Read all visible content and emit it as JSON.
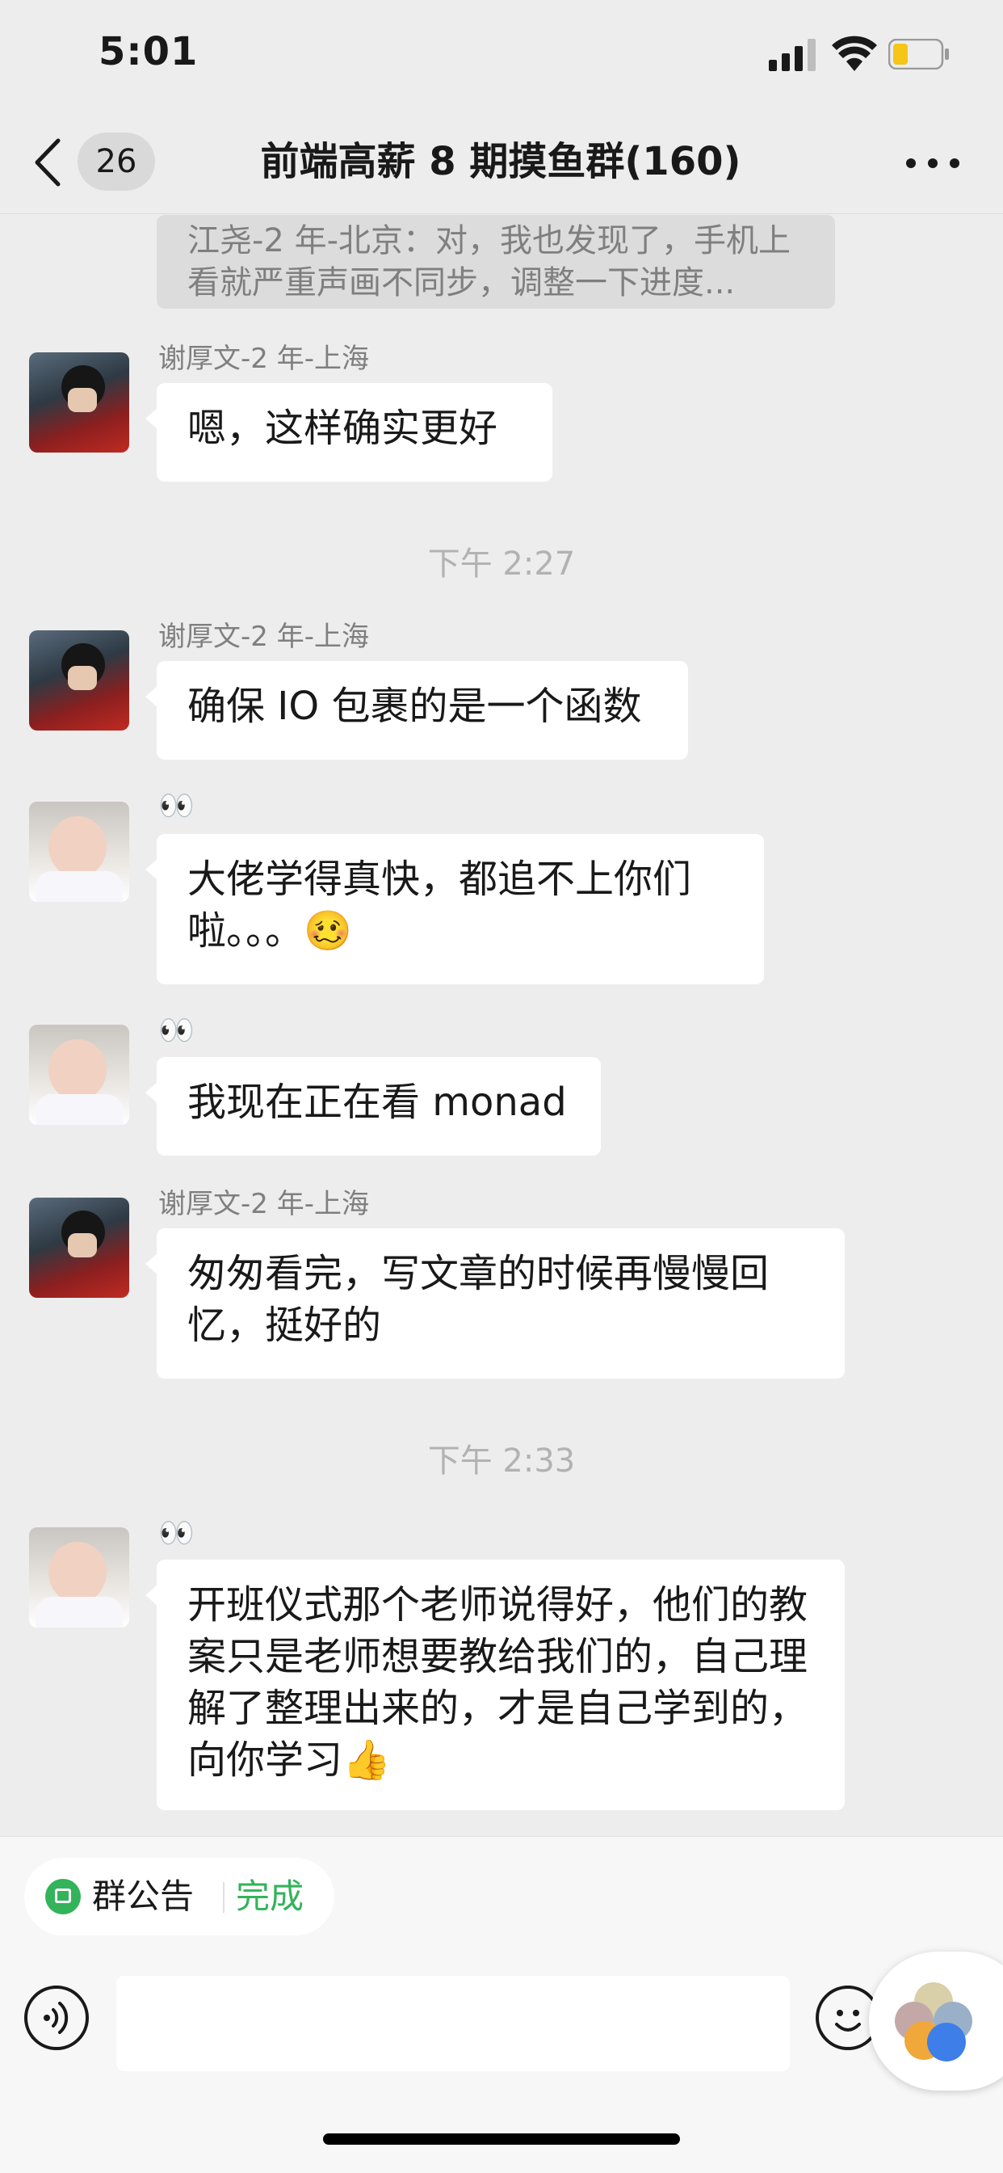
{
  "status_bar": {
    "time": "5:01"
  },
  "header": {
    "unread_count": "26",
    "title": "前端高薪 8 期摸鱼群(160)"
  },
  "quoted_message": "江尧-2 年-北京：对，我也发现了，手机上看就严重声画不同步，调整一下进度...",
  "timestamps": [
    "下午 2:27",
    "下午 2:33"
  ],
  "messages": [
    {
      "sender": "谢厚文-2 年-上海",
      "text": "嗯，这样确实更好",
      "avatar": "red-coat-avatar"
    },
    {
      "sender": "谢厚文-2 年-上海",
      "text": "确保 IO 包裹的是一个函数",
      "avatar": "red-coat-avatar"
    },
    {
      "sender": "👀",
      "text": "大佬学得真快，都追不上你们啦。。。🥴",
      "avatar": "baby-avatar"
    },
    {
      "sender": "👀",
      "text": "我现在正在看 monad",
      "avatar": "baby-avatar"
    },
    {
      "sender": "谢厚文-2 年-上海",
      "text": "匆匆看完，写文章的时候再慢慢回忆，挺好的",
      "avatar": "red-coat-avatar"
    },
    {
      "sender": "👀",
      "text": "开班仪式那个老师说得好，他们的教案只是老师想要教给我们的，自己理解了整理出来的，才是自己学到的，向你学习👍",
      "avatar": "baby-avatar"
    }
  ],
  "notice_bar": {
    "label": "群公告",
    "done": "完成"
  },
  "input_bar": {
    "placeholder": ""
  },
  "colors": {
    "accent": "#33b35a",
    "background": "#ededed",
    "bubble": "#ffffff"
  }
}
